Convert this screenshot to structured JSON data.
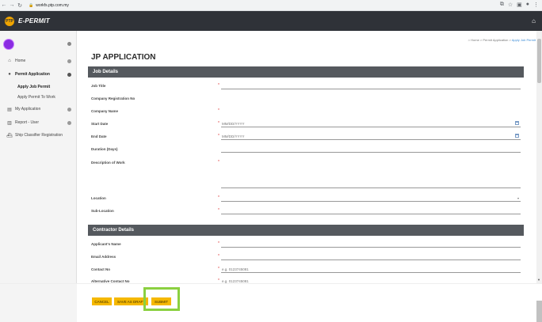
{
  "browser": {
    "url": "workfs.ptp.com.my",
    "back_icon": "arrow-left",
    "forward_icon": "arrow-right",
    "reload_icon": "reload"
  },
  "app": {
    "brand": "E-PERMIT",
    "logo_text": "PTP"
  },
  "sidebar": {
    "items": [
      {
        "label": "Home",
        "icon": "home-icon"
      },
      {
        "label": "Permit Application",
        "icon": "circle-icon"
      },
      {
        "label": "My Application",
        "icon": "document-icon"
      },
      {
        "label": "Report - User",
        "icon": "chart-icon"
      },
      {
        "label": "Ship Classifier Registration",
        "icon": "ship-icon"
      }
    ],
    "sub_items": [
      {
        "label": "Apply Job Permit"
      },
      {
        "label": "Apply Permit To Work"
      }
    ]
  },
  "breadcrumb": {
    "home": "Home",
    "parent": "Permit Application",
    "current": "Apply Job Permit",
    "sep": ">"
  },
  "page": {
    "title": "JP APPLICATION"
  },
  "sections": {
    "job": "Job Details",
    "contractor": "Contractor Details"
  },
  "job_fields": {
    "job_title": "Job Title",
    "company_reg": "Company Registration No",
    "company_name": "Company Name",
    "start_date": "Start Date",
    "end_date": "End Date",
    "duration": "Duration (Days)",
    "description": "Description of Work",
    "location": "Location",
    "sub_location": "Sub-Location"
  },
  "contractor_fields": {
    "applicant_name": "Applicant's Name",
    "email": "Email Address",
    "contact_no": "Contact No",
    "alt_contact": "Alternative Contact No"
  },
  "placeholders": {
    "date": "MM/DD/YYYY",
    "phone": "e.g. 0123745081"
  },
  "required_mark": "*",
  "actions": {
    "cancel": "CANCEL",
    "save_draft": "SAVE AS DRAFT",
    "submit": "SUBMIT"
  },
  "colors": {
    "header_bg": "#2f3238",
    "section_bg": "#55595e",
    "button_bg": "#f5b800",
    "highlight": "#8bd040",
    "link": "#3a8bd6"
  }
}
